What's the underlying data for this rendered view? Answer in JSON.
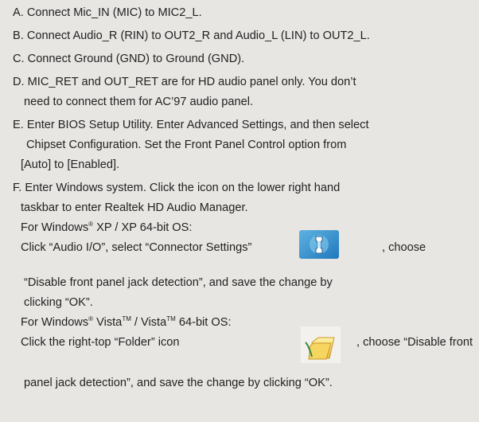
{
  "items": {
    "a": "A. Connect Mic_IN (MIC) to MIC2_L.",
    "b": "B. Connect Audio_R (RIN) to OUT2_R and Audio_L (LIN) to OUT2_L.",
    "c": "C. Connect Ground (GND) to Ground (GND).",
    "d1": "D. MIC_RET and OUT_RET are for HD audio panel only. You don’t",
    "d2": "need to connect them for AC’97 audio panel.",
    "e1": "E. Enter BIOS Setup Utility. Enter Advanced Settings, and then select",
    "e2": "Chipset Configuration. Set the Front Panel Control option from",
    "e3": "[Auto] to [Enabled].",
    "f1": "F. Enter Windows system. Click the icon on the lower right hand",
    "f2": "taskbar to enter Realtek HD Audio Manager."
  },
  "xp": {
    "heading_a": "For Windows",
    "heading_reg": "®",
    "heading_b": " XP / XP 64-bit OS:",
    "line1_a": "Click “Audio I/O”, select “Connector Settings”",
    "line1_b": ", choose",
    "line2": "“Disable front panel jack detection”, and save the change by",
    "line3": "clicking “OK”."
  },
  "vista": {
    "heading_a": "For Windows",
    "heading_reg": "®",
    "heading_b": " Vista",
    "heading_tm1": "TM",
    "heading_c": " / Vista",
    "heading_tm2": "TM",
    "heading_d": " 64-bit OS:",
    "line1_a": "Click the right-top “Folder” icon",
    "line1_b": ", choose “Disable front",
    "line2": "panel jack detection”, and save the change by clicking “OK”."
  },
  "icons": {
    "connector_settings": "connector-settings-icon",
    "folder": "folder-icon"
  }
}
